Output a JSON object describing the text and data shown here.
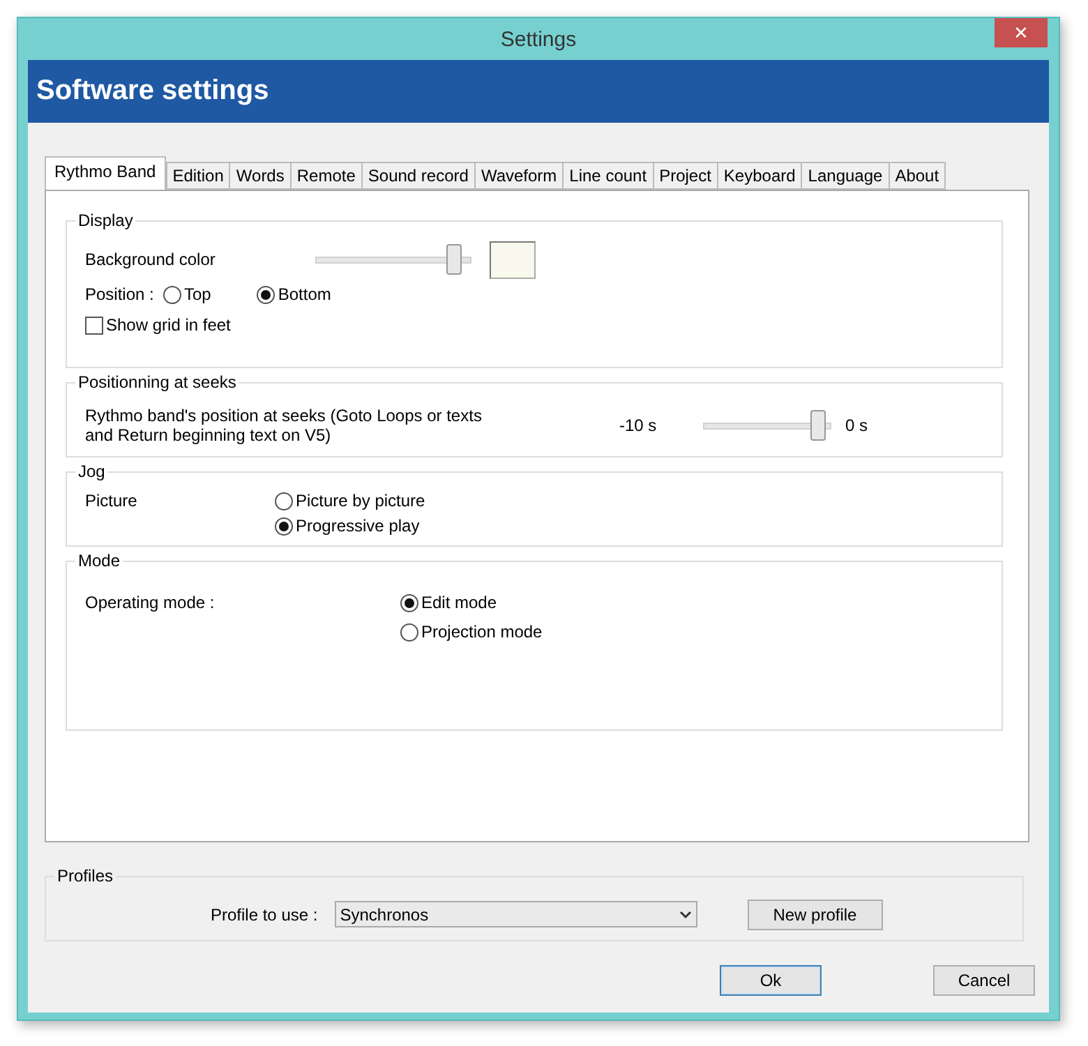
{
  "window": {
    "title": "Settings",
    "close": "✕"
  },
  "header": {
    "title": "Software settings"
  },
  "tabs": [
    {
      "label": "Rythmo Band",
      "selected": true
    },
    {
      "label": "Edition",
      "selected": false
    },
    {
      "label": "Words",
      "selected": false
    },
    {
      "label": "Remote",
      "selected": false
    },
    {
      "label": "Sound record",
      "selected": false
    },
    {
      "label": "Waveform",
      "selected": false
    },
    {
      "label": "Line count",
      "selected": false
    },
    {
      "label": "Project",
      "selected": false
    },
    {
      "label": "Keyboard",
      "selected": false
    },
    {
      "label": "Language",
      "selected": false
    },
    {
      "label": "About",
      "selected": false
    }
  ],
  "display": {
    "title": "Display",
    "background_color": {
      "label": "Background color",
      "level": 0.93
    },
    "position": {
      "label": "Position :",
      "options": [
        {
          "label": "Top",
          "selected": false
        },
        {
          "label": "Bottom",
          "selected": true
        }
      ]
    },
    "show_grid": {
      "label": "Show grid in feet",
      "checked": false
    }
  },
  "positioning": {
    "title": "Positionning at seeks",
    "description": "Rythmo band's position at seeks (Goto Loops or texts and Return beginning text on V5)",
    "min_label": "-10 s",
    "max_label": "0 s",
    "level": 0.95
  },
  "jog": {
    "title": "Jog",
    "label": "Picture",
    "options": [
      {
        "label": "Picture by picture",
        "selected": false
      },
      {
        "label": "Progressive play",
        "selected": true
      }
    ]
  },
  "mode": {
    "title": "Mode",
    "label": "Operating mode :",
    "options": [
      {
        "label": "Edit mode",
        "selected": true
      },
      {
        "label": "Projection mode",
        "selected": false
      }
    ]
  },
  "profiles": {
    "title": "Profiles",
    "label": "Profile to use :",
    "value": "Synchronos",
    "new_button": "New profile"
  },
  "buttons": [
    {
      "label": "Ok",
      "kind": "default"
    },
    {
      "label": "Cancel",
      "kind": "normal"
    }
  ]
}
